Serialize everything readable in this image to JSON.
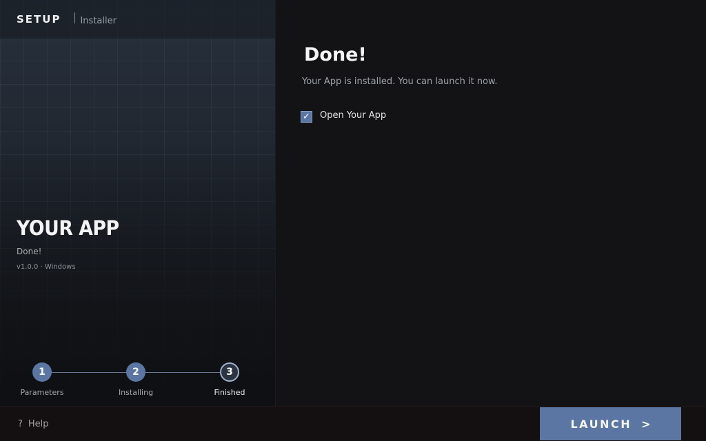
{
  "brand": {
    "title": "SETUP",
    "subtitle": "Installer"
  },
  "app": {
    "name": "YOUR APP",
    "status": "Done!",
    "meta": "v1.0.0 · Windows"
  },
  "steps": [
    {
      "number": "1",
      "label": "Parameters"
    },
    {
      "number": "2",
      "label": "Installing"
    },
    {
      "number": "3",
      "label": "Finished"
    }
  ],
  "current_step": 3,
  "main": {
    "heading": "Done!",
    "message": "Your App is installed. You can launch it now.",
    "open_app": {
      "label": "Open Your App",
      "checked": true,
      "check_glyph": "✓"
    }
  },
  "footer": {
    "help_icon": "?",
    "help_label": "Help",
    "launch_label": "LAUNCH",
    "launch_arrow": ">"
  },
  "colors": {
    "accent": "#5b76a3",
    "background": "#131315",
    "footer": "#140f10"
  }
}
